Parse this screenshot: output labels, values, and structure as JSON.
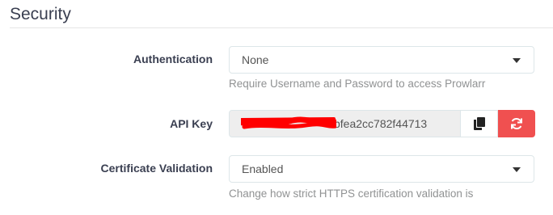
{
  "section": {
    "title": "Security"
  },
  "authentication": {
    "label": "Authentication",
    "value": "None",
    "help": "Require Username and Password to access Prowlarr"
  },
  "api_key": {
    "label": "API Key",
    "value": "bfea2cc782f44713",
    "copy_icon": "copy-icon",
    "regenerate_icon": "refresh-icon"
  },
  "certificate_validation": {
    "label": "Certificate Validation",
    "value": "Enabled",
    "help": "Change how strict HTTPS certification validation is"
  },
  "colors": {
    "danger": "#f05050",
    "redaction": "#ff0000"
  }
}
